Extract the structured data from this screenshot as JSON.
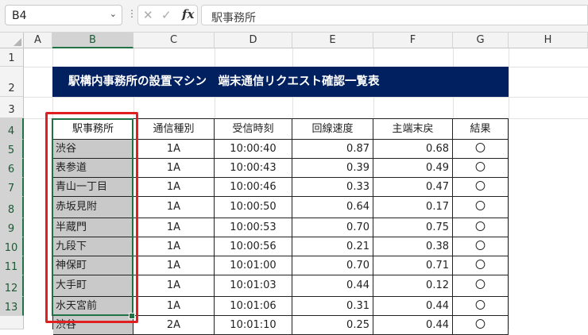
{
  "formula_bar": {
    "name_box": "B4",
    "formula": "駅事務所",
    "fx_label": "fx",
    "cancel_icon": "x-icon",
    "confirm_icon": "check-icon"
  },
  "columns": [
    "A",
    "B",
    "C",
    "D",
    "E",
    "F",
    "G",
    "H"
  ],
  "rows": [
    "1",
    "2",
    "3",
    "4",
    "5",
    "6",
    "7",
    "8",
    "9",
    "10",
    "11",
    "12",
    "13"
  ],
  "sheet": {
    "title": "駅構内事務所の設置マシン　端末通信リクエスト確認一覧表",
    "headers": {
      "station": "駅事務所",
      "type": "通信種別",
      "time": "受信時刻",
      "speed": "回線速度",
      "terminal": "主端末戻",
      "result": "結果"
    },
    "records": [
      {
        "station": "渋谷",
        "type": "1A",
        "time": "10:00:40",
        "speed": "0.87",
        "terminal": "0.68",
        "result": "〇"
      },
      {
        "station": "表参道",
        "type": "1A",
        "time": "10:00:43",
        "speed": "0.39",
        "terminal": "0.49",
        "result": "〇"
      },
      {
        "station": "青山一丁目",
        "type": "1A",
        "time": "10:00:46",
        "speed": "0.33",
        "terminal": "0.47",
        "result": "〇"
      },
      {
        "station": "赤坂見附",
        "type": "1A",
        "time": "10:00:50",
        "speed": "0.64",
        "terminal": "0.17",
        "result": "〇"
      },
      {
        "station": "半蔵門",
        "type": "1A",
        "time": "10:00:53",
        "speed": "0.70",
        "terminal": "0.75",
        "result": "〇"
      },
      {
        "station": "九段下",
        "type": "1A",
        "time": "10:00:56",
        "speed": "0.21",
        "terminal": "0.38",
        "result": "〇"
      },
      {
        "station": "神保町",
        "type": "1A",
        "time": "10:01:00",
        "speed": "0.70",
        "terminal": "0.71",
        "result": "〇"
      },
      {
        "station": "大手町",
        "type": "1A",
        "time": "10:01:03",
        "speed": "0.44",
        "terminal": "0.12",
        "result": "〇"
      },
      {
        "station": "水天宮前",
        "type": "1A",
        "time": "10:01:06",
        "speed": "0.31",
        "terminal": "0.44",
        "result": "〇"
      },
      {
        "station": "渋谷",
        "type": "2A",
        "time": "10:01:10",
        "speed": "0.25",
        "terminal": "0.44",
        "result": "〇"
      }
    ]
  },
  "colors": {
    "title_bg": "#002060",
    "selection": "#217346",
    "highlight_box": "#e02020",
    "station_fill": "#c9c9c9"
  }
}
